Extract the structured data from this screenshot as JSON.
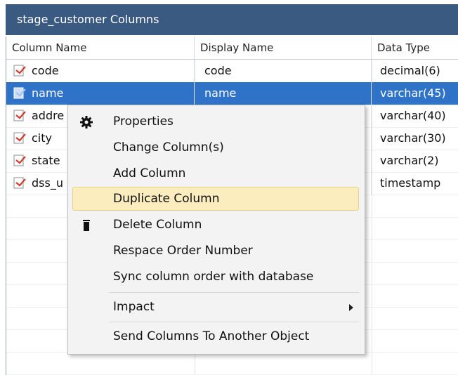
{
  "window": {
    "title": "stage_customer Columns"
  },
  "table": {
    "headers": [
      "Column Name",
      "Display Name",
      "Data Type"
    ],
    "rows": [
      {
        "name": "code",
        "display": "code",
        "type": "decimal(6)",
        "selected": false
      },
      {
        "name": "name",
        "display": "name",
        "type": "varchar(45)",
        "selected": true
      },
      {
        "name": "addre",
        "display": "",
        "type": "varchar(40)",
        "selected": false
      },
      {
        "name": "city",
        "display": "",
        "type": "varchar(30)",
        "selected": false
      },
      {
        "name": "state",
        "display": "",
        "type": "varchar(2)",
        "selected": false
      },
      {
        "name": "dss_u",
        "display": "",
        "type": "timestamp",
        "selected": false
      }
    ]
  },
  "context_menu": {
    "items": [
      {
        "label": "Properties",
        "icon": "gear-icon"
      },
      {
        "label": "Change Column(s)"
      },
      {
        "label": "Add Column"
      },
      {
        "label": "Duplicate Column",
        "highlighted": true
      },
      {
        "label": "Delete Column",
        "icon": "trash-icon"
      },
      {
        "label": "Respace Order Number"
      },
      {
        "label": "Sync column order with database"
      },
      {
        "label": "Impact",
        "submenu": true
      },
      {
        "label": "Send Columns To Another Object"
      }
    ]
  },
  "colors": {
    "title_bar": "#3a5a82",
    "selection": "#2f73c8",
    "menu_highlight": "#fbedbe"
  }
}
